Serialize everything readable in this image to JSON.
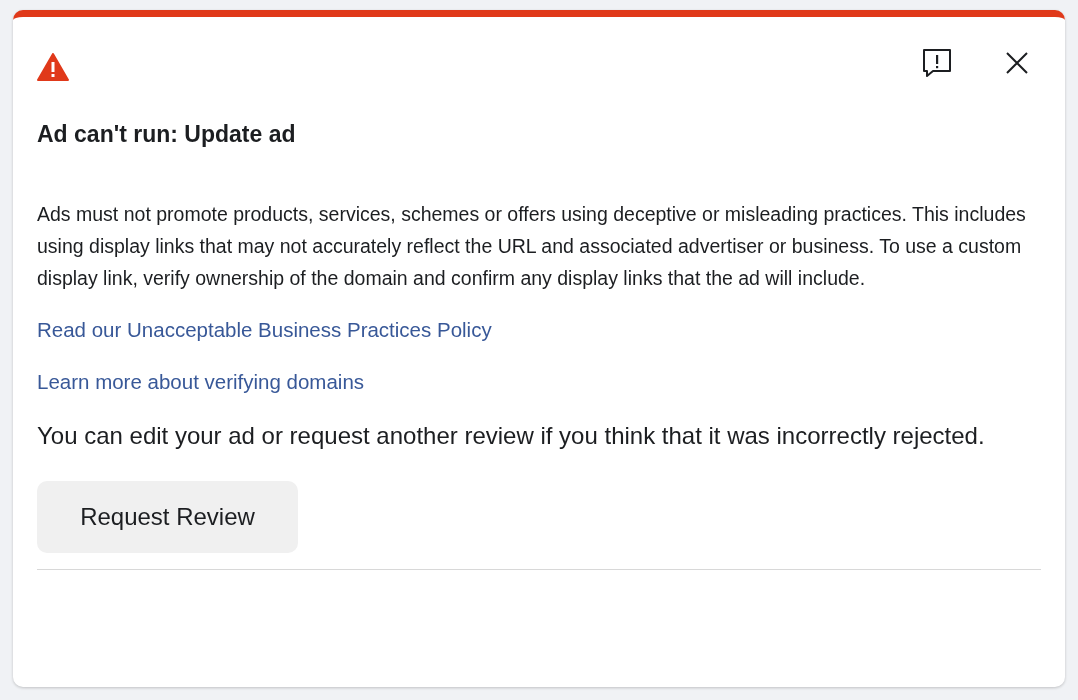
{
  "title": "Ad can't run: Update ad",
  "description": "Ads must not promote products, services, schemes or offers using deceptive or misleading practices. This includes using display links that may not accurately reflect the URL and associated advertiser or business. To use a custom display link, verify ownership of the domain and confirm any display links that the ad will include.",
  "links": [
    "Read our Unacceptable Business Practices Policy",
    "Learn more about verifying domains"
  ],
  "note": "You can edit your ad or request another review if you think that it was incorrectly rejected.",
  "buttons": [
    "Request Review"
  ]
}
